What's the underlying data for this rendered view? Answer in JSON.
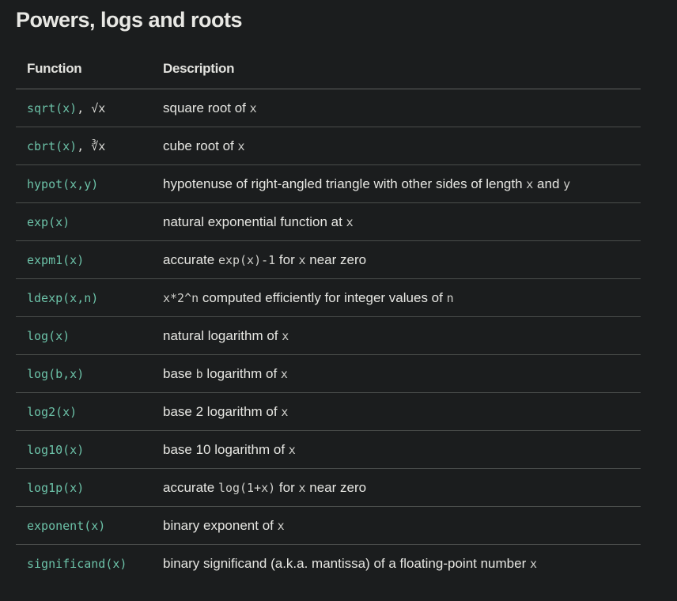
{
  "title": "Powers, logs and roots",
  "headers": {
    "function": "Function",
    "description": "Description"
  },
  "rows": [
    {
      "fn": [
        {
          "t": "sqrt(x)",
          "c": true
        },
        {
          "t": ", √x",
          "c": false
        }
      ],
      "desc": [
        {
          "t": "square root of ",
          "c": false
        },
        {
          "t": "x",
          "c": true
        }
      ]
    },
    {
      "fn": [
        {
          "t": "cbrt(x)",
          "c": true
        },
        {
          "t": ", ∛x",
          "c": false
        }
      ],
      "desc": [
        {
          "t": "cube root of ",
          "c": false
        },
        {
          "t": "x",
          "c": true
        }
      ]
    },
    {
      "fn": [
        {
          "t": "hypot(x,y)",
          "c": true
        }
      ],
      "desc": [
        {
          "t": "hypotenuse of right-angled triangle with other sides of length ",
          "c": false
        },
        {
          "t": "x",
          "c": true
        },
        {
          "t": " and ",
          "c": false
        },
        {
          "t": "y",
          "c": true
        }
      ]
    },
    {
      "fn": [
        {
          "t": "exp(x)",
          "c": true
        }
      ],
      "desc": [
        {
          "t": "natural exponential function at ",
          "c": false
        },
        {
          "t": "x",
          "c": true
        }
      ]
    },
    {
      "fn": [
        {
          "t": "expm1(x)",
          "c": true
        }
      ],
      "desc": [
        {
          "t": "accurate ",
          "c": false
        },
        {
          "t": "exp(x)-1",
          "c": true
        },
        {
          "t": " for ",
          "c": false
        },
        {
          "t": "x",
          "c": true
        },
        {
          "t": " near zero",
          "c": false
        }
      ]
    },
    {
      "fn": [
        {
          "t": "ldexp(x,n)",
          "c": true
        }
      ],
      "desc": [
        {
          "t": "x*2^n",
          "c": true
        },
        {
          "t": " computed efficiently for integer values of ",
          "c": false
        },
        {
          "t": "n",
          "c": true
        }
      ]
    },
    {
      "fn": [
        {
          "t": "log(x)",
          "c": true
        }
      ],
      "desc": [
        {
          "t": "natural logarithm of ",
          "c": false
        },
        {
          "t": "x",
          "c": true
        }
      ]
    },
    {
      "fn": [
        {
          "t": "log(b,x)",
          "c": true
        }
      ],
      "desc": [
        {
          "t": "base ",
          "c": false
        },
        {
          "t": "b",
          "c": true
        },
        {
          "t": " logarithm of ",
          "c": false
        },
        {
          "t": "x",
          "c": true
        }
      ]
    },
    {
      "fn": [
        {
          "t": "log2(x)",
          "c": true
        }
      ],
      "desc": [
        {
          "t": "base 2 logarithm of ",
          "c": false
        },
        {
          "t": "x",
          "c": true
        }
      ]
    },
    {
      "fn": [
        {
          "t": "log10(x)",
          "c": true
        }
      ],
      "desc": [
        {
          "t": "base 10 logarithm of ",
          "c": false
        },
        {
          "t": "x",
          "c": true
        }
      ]
    },
    {
      "fn": [
        {
          "t": "log1p(x)",
          "c": true
        }
      ],
      "desc": [
        {
          "t": "accurate ",
          "c": false
        },
        {
          "t": "log(1+x)",
          "c": true
        },
        {
          "t": " for ",
          "c": false
        },
        {
          "t": "x",
          "c": true
        },
        {
          "t": " near zero",
          "c": false
        }
      ]
    },
    {
      "fn": [
        {
          "t": "exponent(x)",
          "c": true
        }
      ],
      "desc": [
        {
          "t": "binary exponent of ",
          "c": false
        },
        {
          "t": "x",
          "c": true
        }
      ]
    },
    {
      "fn": [
        {
          "t": "significand(x)",
          "c": true
        }
      ],
      "desc": [
        {
          "t": "binary significand (a.k.a. mantissa) of a floating-point number ",
          "c": false
        },
        {
          "t": "x",
          "c": true
        }
      ]
    }
  ]
}
